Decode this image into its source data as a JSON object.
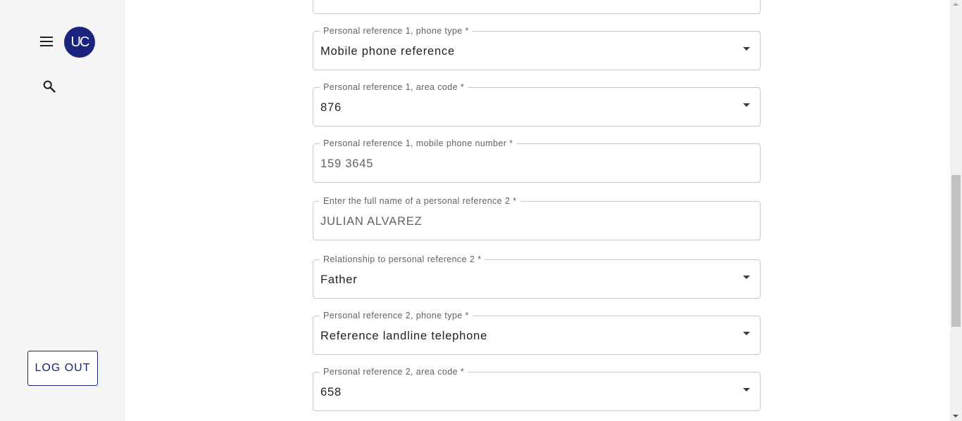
{
  "sidebar": {
    "avatar_initials": "UC",
    "menu_icon": "hamburger-menu-icon",
    "search_icon": "search-icon",
    "logout_label": "LOG OUT"
  },
  "colors": {
    "brand": "#1a237e",
    "sidebar_bg": "#f5f5f5",
    "field_border": "#c9c9c9"
  },
  "form": {
    "fields": [
      {
        "label": "",
        "value": "",
        "type": "text"
      },
      {
        "label": "Personal reference 1, phone type *",
        "value": "Mobile phone reference",
        "type": "select"
      },
      {
        "label": "Personal reference 1, area code *",
        "value": "876",
        "type": "select"
      },
      {
        "label": "Personal reference 1, mobile phone number *",
        "value": "159 3645",
        "type": "text"
      },
      {
        "label": "Enter the full name of a personal reference 2 *",
        "value": "JULIAN ALVAREZ",
        "type": "text"
      },
      {
        "label": "Relationship to personal reference 2 *",
        "value": "Father",
        "type": "select"
      },
      {
        "label": "Personal reference 2, phone type *",
        "value": "Reference landline telephone",
        "type": "select"
      },
      {
        "label": "Personal reference 2, area code *",
        "value": "658",
        "type": "select"
      }
    ]
  }
}
